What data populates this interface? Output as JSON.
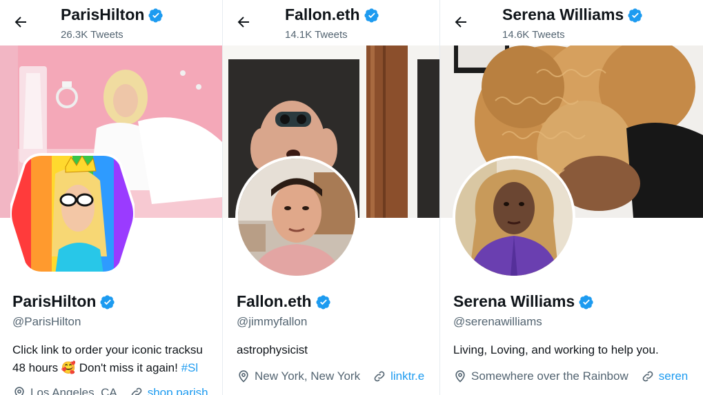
{
  "profiles": [
    {
      "header": {
        "name": "ParisHilton",
        "tweets": "26.3K Tweets"
      },
      "name": "ParisHilton",
      "handle": "@ParisHilton",
      "bio_line1": "Click link to order your iconic tracksu",
      "bio_line2_text": "48 hours 🥰 Don't miss it again! ",
      "bio_line2_tag": "#Sl",
      "location": "Los Angeles, CA",
      "link": "shop.parish"
    },
    {
      "header": {
        "name": "Fallon.eth",
        "tweets": "14.1K Tweets"
      },
      "name": "Fallon.eth",
      "handle": "@jimmyfallon",
      "bio_line1": "astrophysicist",
      "location": "New York, New York",
      "link": "linktr.e"
    },
    {
      "header": {
        "name": "Serena Williams",
        "tweets": "14.6K Tweets"
      },
      "name": "Serena Williams",
      "handle": "@serenawilliams",
      "bio_line1": "Living, Loving, and working to help you.",
      "location": "Somewhere over the Rainbow",
      "link": "seren"
    }
  ],
  "icons": {
    "back": "arrow-left-icon",
    "verified": "verified-badge-icon",
    "location": "location-pin-icon",
    "link": "link-icon"
  },
  "colors": {
    "accent": "#1d9bf0",
    "text": "#0f1419",
    "secondary": "#536471"
  }
}
